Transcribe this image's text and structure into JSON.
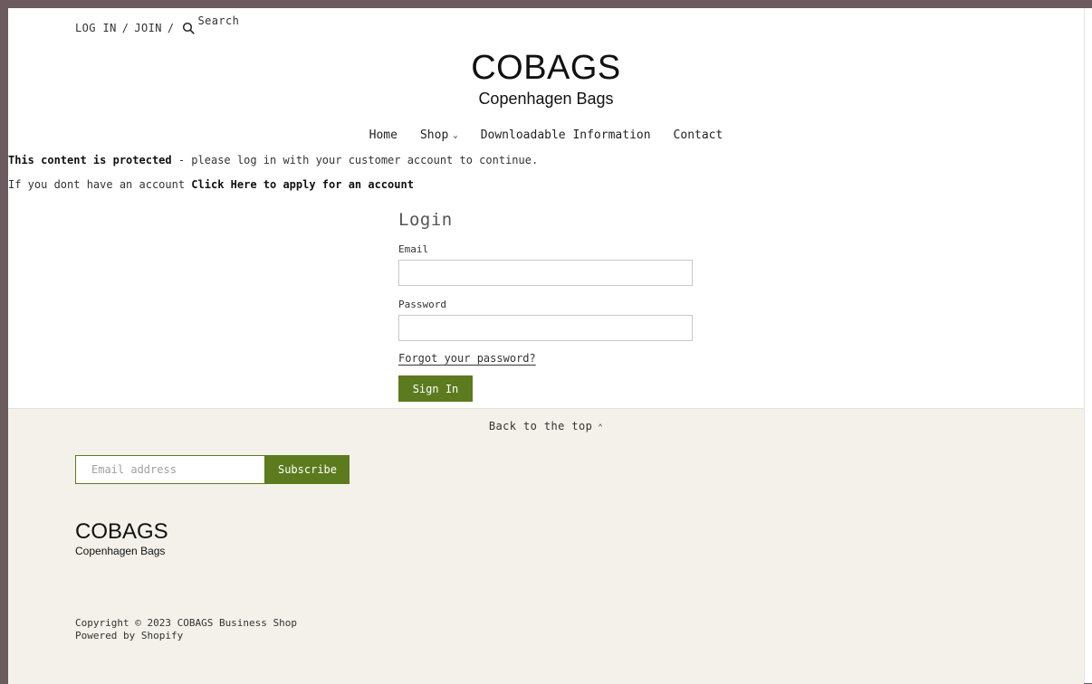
{
  "header": {
    "login_label": "LOG IN",
    "join_label": "JOIN",
    "separator": "/",
    "search_label": "Search"
  },
  "logo": {
    "brand": "COBAGS",
    "subtitle": "Copenhagen Bags"
  },
  "nav": {
    "items": [
      {
        "label": "Home"
      },
      {
        "label": "Shop",
        "has_dropdown": true
      },
      {
        "label": "Downloadable Information"
      },
      {
        "label": "Contact"
      }
    ]
  },
  "notice": {
    "bold": "This content is protected",
    "rest": " - please log in with your customer account to continue.",
    "account_prefix": "If you dont have an account ",
    "account_link": "Click Here to apply for an account"
  },
  "login": {
    "title": "Login",
    "email_label": "Email",
    "password_label": "Password",
    "forgot_label": "Forgot your password?",
    "signin_label": "Sign In"
  },
  "footer": {
    "back_to_top": "Back to the top",
    "email_placeholder": "Email address",
    "subscribe_label": "Subscribe",
    "brand": "COBAGS",
    "subtitle": "Copenhagen Bags",
    "copyright": "Copyright © 2023 COBAGS Business Shop",
    "powered_by": "Powered by Shopify"
  },
  "colors": {
    "accent": "#5c7b1e",
    "footer_bg": "#f4f1ea",
    "frame": "#6b5a5e"
  }
}
